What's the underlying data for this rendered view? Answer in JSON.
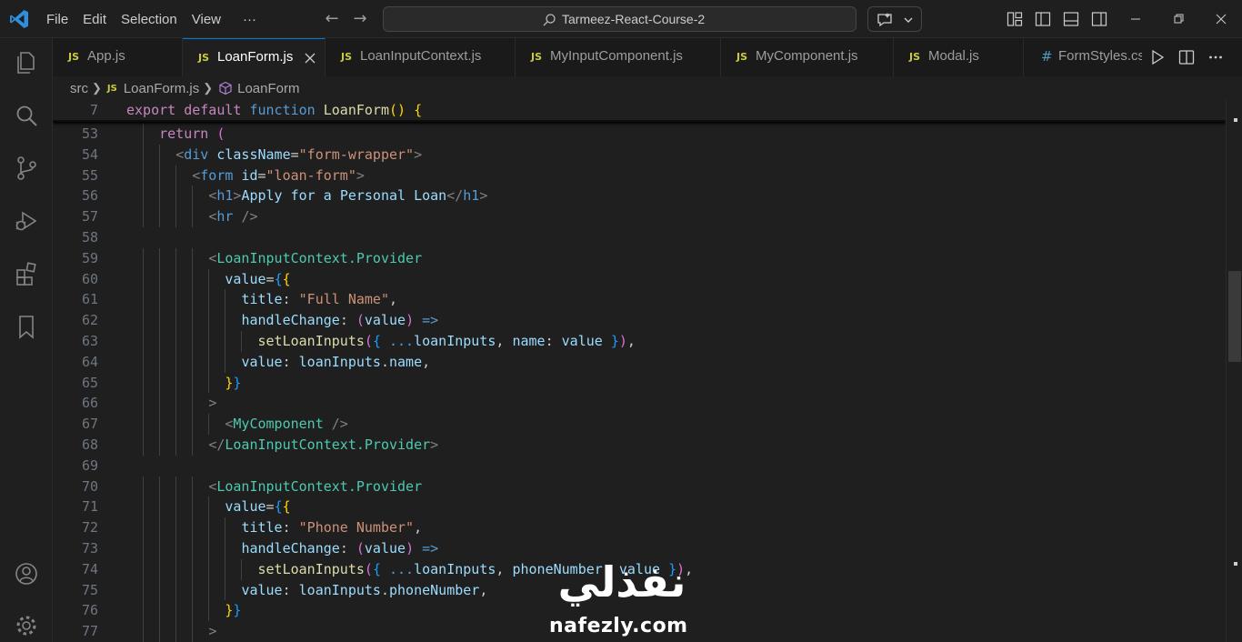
{
  "menu": [
    "File",
    "Edit",
    "Selection",
    "View",
    "···"
  ],
  "search": {
    "label": "Tarmeez-React-Course-2"
  },
  "tabs": [
    {
      "name": "App.js",
      "type": "js",
      "active": false
    },
    {
      "name": "LoanForm.js",
      "type": "js",
      "active": true
    },
    {
      "name": "LoanInputContext.js",
      "type": "js",
      "active": false
    },
    {
      "name": "MyInputComponent.js",
      "type": "js",
      "active": false
    },
    {
      "name": "MyComponent.js",
      "type": "js",
      "active": false
    },
    {
      "name": "Modal.js",
      "type": "js",
      "active": false
    },
    {
      "name": "FormStyles.cs",
      "type": "css",
      "active": false
    }
  ],
  "breadcrumb": {
    "folder": "src",
    "file": "LoanForm.js",
    "symbol": "LoanForm"
  },
  "sticky_line": {
    "number": "7",
    "text": "export default function LoanForm() {"
  },
  "code_lines": [
    {
      "n": "53",
      "text": "    return ("
    },
    {
      "n": "54",
      "text": "      <div className=\"form-wrapper\">"
    },
    {
      "n": "55",
      "text": "        <form id=\"loan-form\">"
    },
    {
      "n": "56",
      "text": "          <h1>Apply for a Personal Loan</h1>"
    },
    {
      "n": "57",
      "text": "          <hr />"
    },
    {
      "n": "58",
      "text": ""
    },
    {
      "n": "59",
      "text": "          <LoanInputContext.Provider"
    },
    {
      "n": "60",
      "text": "            value={{"
    },
    {
      "n": "61",
      "text": "              title: \"Full Name\","
    },
    {
      "n": "62",
      "text": "              handleChange: (value) =>"
    },
    {
      "n": "63",
      "text": "                setLoanInputs({ ...loanInputs, name: value }),"
    },
    {
      "n": "64",
      "text": "              value: loanInputs.name,"
    },
    {
      "n": "65",
      "text": "            }}"
    },
    {
      "n": "66",
      "text": "          >"
    },
    {
      "n": "67",
      "text": "            <MyComponent />"
    },
    {
      "n": "68",
      "text": "          </LoanInputContext.Provider>"
    },
    {
      "n": "69",
      "text": ""
    },
    {
      "n": "70",
      "text": "          <LoanInputContext.Provider"
    },
    {
      "n": "71",
      "text": "            value={{"
    },
    {
      "n": "72",
      "text": "              title: \"Phone Number\","
    },
    {
      "n": "73",
      "text": "              handleChange: (value) =>"
    },
    {
      "n": "74",
      "text": "                setLoanInputs({ ...loanInputs, phoneNumber: value }),"
    },
    {
      "n": "75",
      "text": "              value: loanInputs.phoneNumber,"
    },
    {
      "n": "76",
      "text": "            }}"
    },
    {
      "n": "77",
      "text": "          >"
    }
  ],
  "watermark": {
    "arabic": "نفذلي",
    "latin": "nafezly.com"
  },
  "colors": {
    "accent": "#0078d4",
    "background": "#1f1f1f",
    "js_badge": "#cbcb41"
  }
}
